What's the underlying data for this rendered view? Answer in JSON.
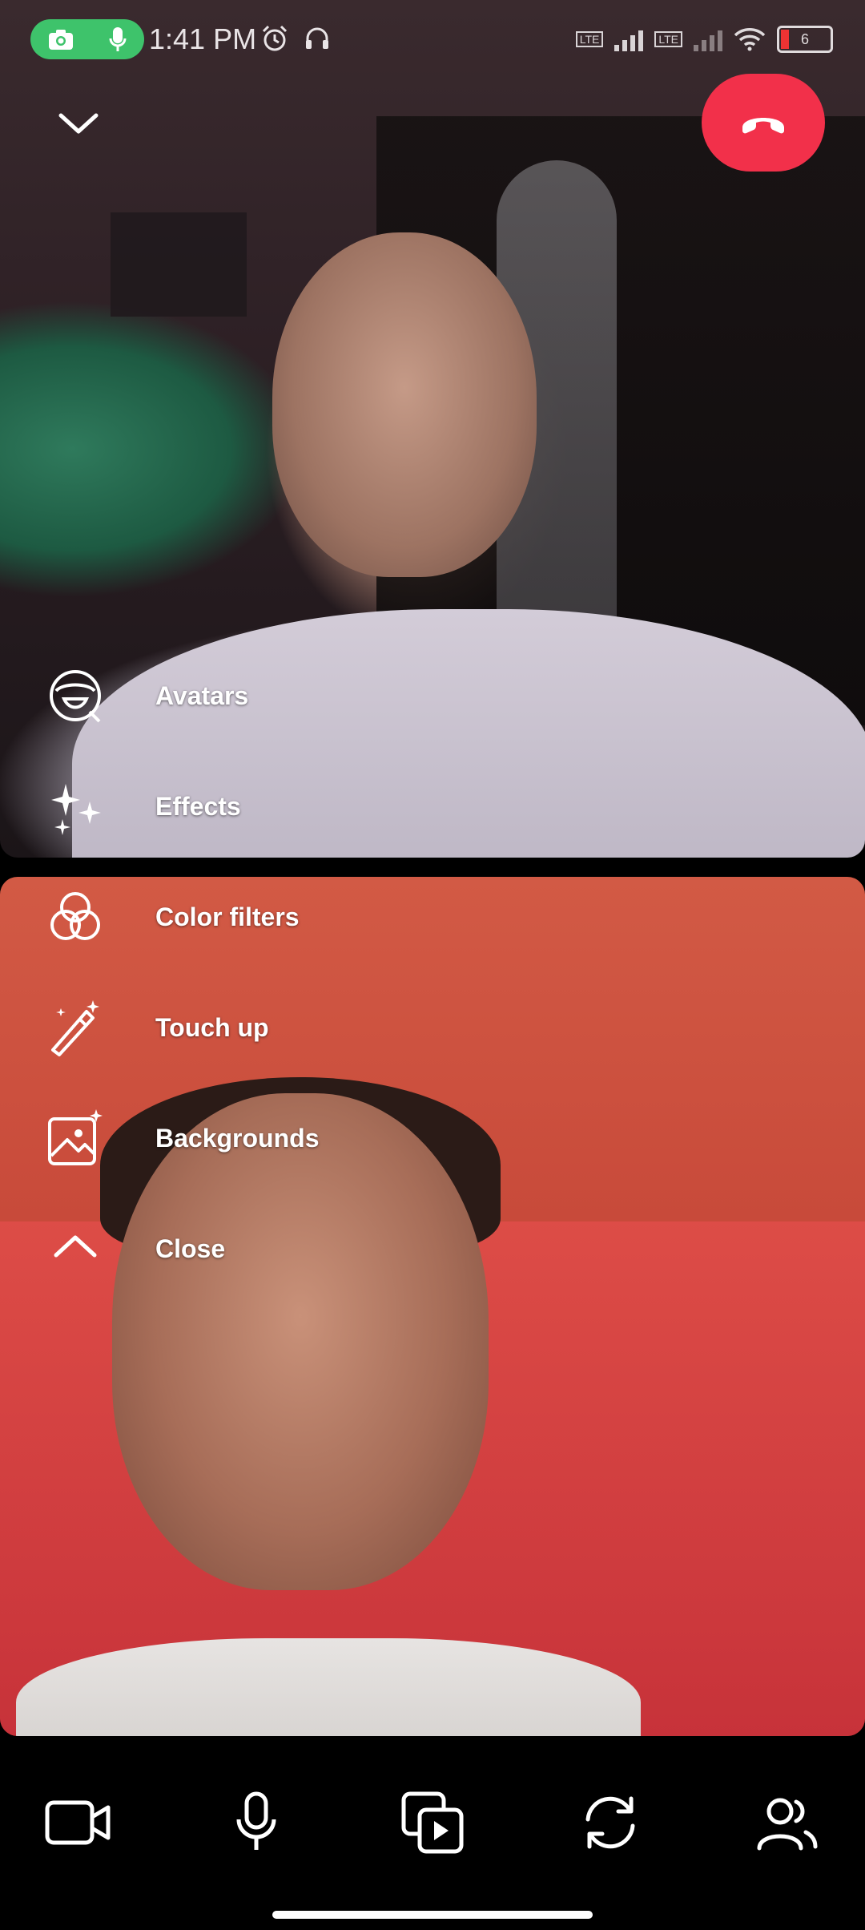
{
  "status_bar": {
    "time": "1:41 PM",
    "battery_level": "6",
    "network_badge": "LTE"
  },
  "call": {
    "end_call_color": "#f2304a",
    "recording_indicator_color": "#3ec36b"
  },
  "effects_menu": {
    "items": [
      {
        "label": "Avatars",
        "icon": "avatar-face-icon"
      },
      {
        "label": "Effects",
        "icon": "sparkles-icon"
      },
      {
        "label": "Color filters",
        "icon": "color-filters-icon"
      },
      {
        "label": "Touch up",
        "icon": "magic-wand-icon"
      },
      {
        "label": "Backgrounds",
        "icon": "background-image-icon"
      },
      {
        "label": "Close",
        "icon": "chevron-up-icon"
      }
    ]
  },
  "toolbar": {
    "buttons": [
      {
        "icon": "video-camera-icon"
      },
      {
        "icon": "microphone-icon"
      },
      {
        "icon": "share-media-icon"
      },
      {
        "icon": "flip-camera-icon"
      },
      {
        "icon": "participants-icon"
      }
    ]
  }
}
